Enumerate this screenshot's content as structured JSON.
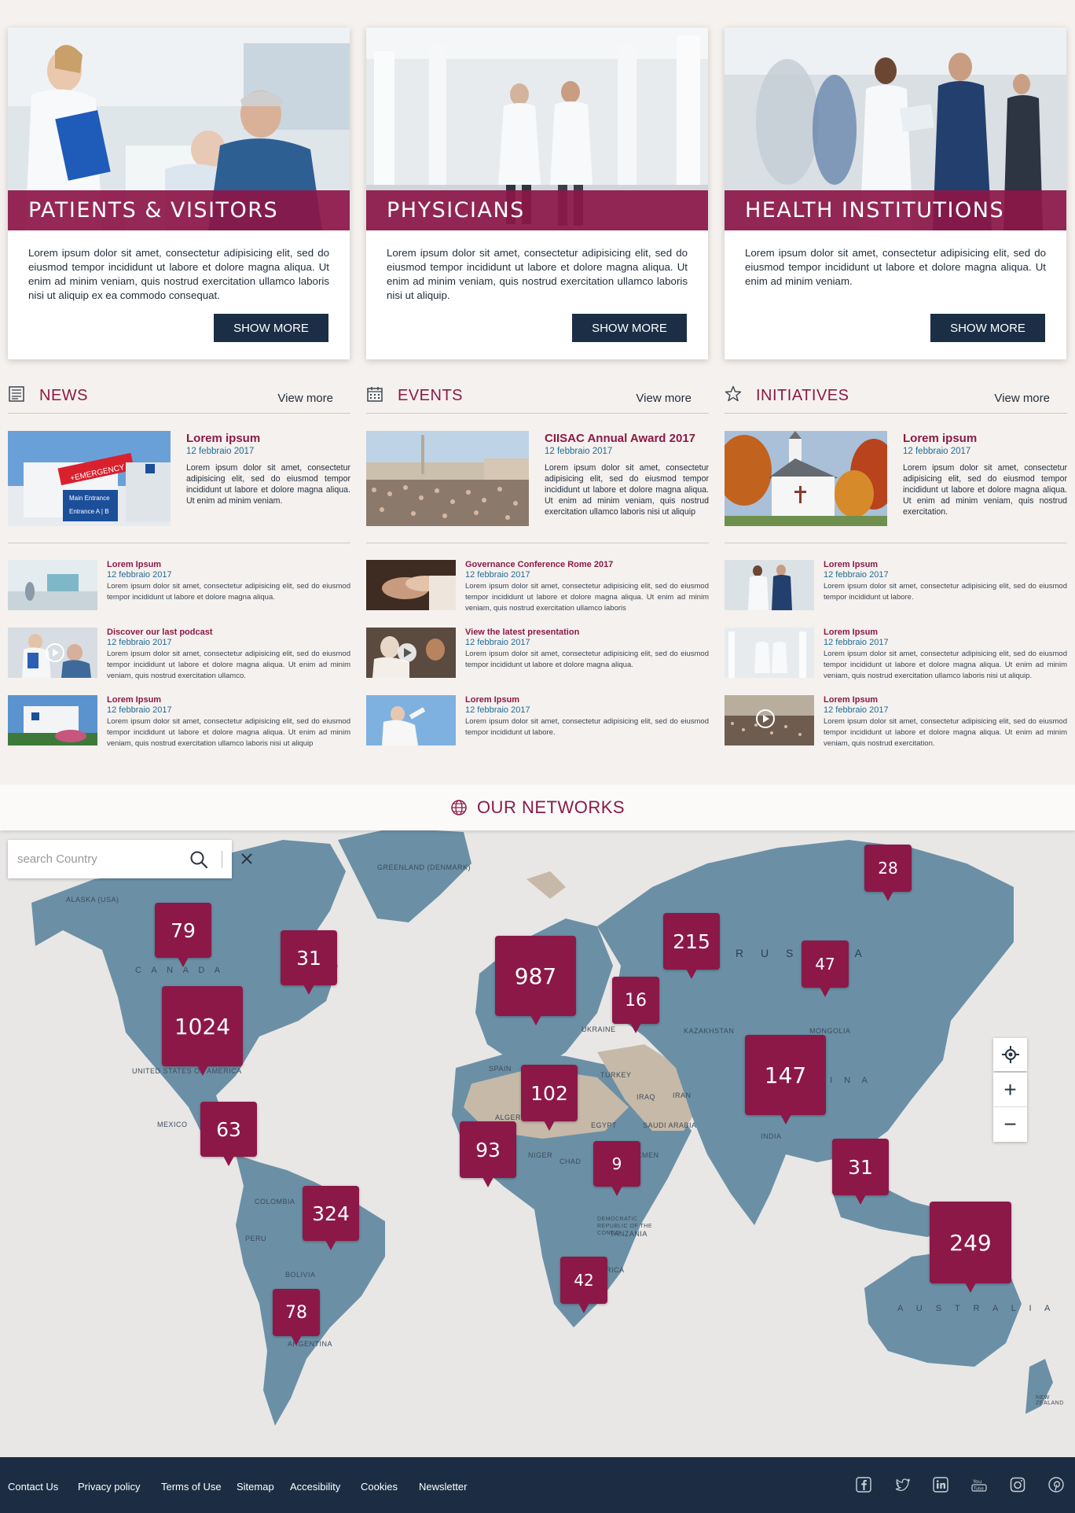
{
  "cards": [
    {
      "title": "PATIENTS & VISITORS",
      "text": "Lorem ipsum dolor sit amet, consectetur adipisicing elit, sed do eiusmod tempor incididunt ut labore et dolore magna aliqua. Ut enim ad minim veniam, quis nostrud exercitation ullamco laboris nisi ut aliquip ex ea commodo consequat.",
      "button": "SHOW MORE"
    },
    {
      "title": "PHYSICIANS",
      "text": "Lorem ipsum dolor sit amet, consectetur adipisicing elit, sed do eiusmod tempor incididunt ut labore et dolore magna aliqua. Ut enim ad minim veniam, quis nostrud exercitation ullamco laboris nisi ut aliquip.",
      "button": "SHOW MORE"
    },
    {
      "title": "HEALTH INSTITUTIONS",
      "text": "Lorem ipsum dolor sit amet, consectetur adipisicing elit, sed do eiusmod tempor incididunt ut labore et dolore magna aliqua. Ut enim ad minim veniam.",
      "button": "SHOW MORE"
    }
  ],
  "columns": [
    {
      "title": "NEWS",
      "icon": "newspaper-icon",
      "view_more": "View more",
      "featured": {
        "title": "Lorem ipsum",
        "date": "12 febbraio 2017",
        "text": "Lorem ipsum dolor sit amet, consectetur adipisicing elit, sed do eiusmod tempor incididunt ut labore et dolore magna aliqua. Ut enim ad minim veniam."
      },
      "items": [
        {
          "title": "Lorem Ipsum",
          "date": "12 febbraio 2017",
          "text": "Lorem ipsum dolor sit amet, consectetur adipisicing elit, sed do eiusmod tempor incididunt ut labore et dolore magna aliqua."
        },
        {
          "title": "Discover our last podcast",
          "date": "12 febbraio 2017",
          "text": "Lorem ipsum dolor sit amet, consectetur adipisicing elit, sed do eiusmod tempor incididunt ut labore et dolore magna aliqua. Ut enim ad minim veniam, quis nostrud exercitation ullamco."
        },
        {
          "title": "Lorem Ipsum",
          "date": "12 febbraio 2017",
          "text": "Lorem ipsum dolor sit amet, consectetur adipisicing elit, sed do eiusmod tempor incididunt ut labore et dolore magna aliqua. Ut enim ad minim veniam, quis nostrud exercitation ullamco laboris nisi ut aliquip"
        }
      ]
    },
    {
      "title": "EVENTS",
      "icon": "calendar-icon",
      "view_more": "View more",
      "featured": {
        "title": "CIISAC Annual Award 2017",
        "date": "12 febbraio 2017",
        "text": "Lorem ipsum dolor sit amet, consectetur adipisicing elit, sed do eiusmod tempor incididunt ut labore et dolore magna aliqua. Ut enim ad minim veniam, quis nostrud exercitation ullamco laboris nisi ut aliquip"
      },
      "items": [
        {
          "title": "Governance Conference Rome 2017",
          "date": "12 febbraio 2017",
          "text": "Lorem ipsum dolor sit amet, consectetur adipisicing elit, sed do eiusmod tempor incididunt ut labore et dolore magna aliqua. Ut enim ad minim veniam, quis nostrud exercitation ullamco laboris"
        },
        {
          "title": "View the latest presentation",
          "date": "12 febbraio 2017",
          "text": "Lorem ipsum dolor sit amet, consectetur adipisicing elit, sed do eiusmod tempor incididunt ut labore et dolore magna aliqua."
        },
        {
          "title": "Lorem Ipsum",
          "date": "12 febbraio 2017",
          "text": "Lorem ipsum dolor sit amet, consectetur adipisicing elit, sed do eiusmod tempor incididunt ut labore."
        }
      ]
    },
    {
      "title": "INITIATIVES",
      "icon": "star-icon",
      "view_more": "View more",
      "featured": {
        "title": "Lorem ipsum",
        "date": "12 febbraio 2017",
        "text": "Lorem ipsum dolor sit amet, consectetur adipisicing elit, sed do eiusmod tempor incididunt ut labore et dolore magna aliqua. Ut enim ad minim veniam, quis nostrud exercitation."
      },
      "items": [
        {
          "title": "Lorem Ipsum",
          "date": "12 febbraio 2017",
          "text": "Lorem ipsum dolor sit amet, consectetur adipisicing elit, sed do eiusmod tempor incididunt ut labore."
        },
        {
          "title": "Lorem Ipsum",
          "date": "12 febbraio 2017",
          "text": "Lorem ipsum dolor sit amet, consectetur adipisicing elit, sed do eiusmod tempor incididunt ut labore et dolore magna aliqua. Ut enim ad minim veniam, quis nostrud exercitation ullamco laboris nisi ut aliquip."
        },
        {
          "title": "Lorem Ipsum",
          "date": "12 febbraio 2017",
          "text": "Lorem ipsum dolor sit amet, consectetur adipisicing elit, sed do eiusmod tempor incididunt ut labore et dolore magna aliqua. Ut enim ad minim veniam, quis nostrud exercitation."
        }
      ]
    }
  ],
  "map": {
    "title": "OUR NETWORKS",
    "search_placeholder": "search Country",
    "labels": {
      "greenland": "GREENLAND (DENMARK)",
      "alaska": "ALASKA (USA)",
      "canada": "C A N A D A",
      "usa": "UNITED STATES OF AMERICA",
      "mexico": "MEXICO",
      "colombia": "COLOMBIA",
      "peru": "PERU",
      "bolivia": "BOLIVIA",
      "argentina": "ARGENTINA",
      "russia": "R U S S I A",
      "kazakhstan": "KAZAKHSTAN",
      "mongolia": "MONGOLIA",
      "china": "C H I N A",
      "india": "INDIA",
      "iran": "IRAN",
      "iraq": "IRAQ",
      "turkey": "TURKEY",
      "egypt": "EGYPT",
      "saudi": "SAUDI ARABIA",
      "algeria": "ALGERIA",
      "niger": "NIGER",
      "chad": "CHAD",
      "ukraine": "UKRAINE",
      "spain": "SPAIN",
      "australia": "A U S T R A L I A",
      "south_africa": "SOUTH AFRICA",
      "tanzania": "TANZANIA",
      "yemen": "YEMEN",
      "drc": "DEMOCRATIC REPUBLIC OF THE CONGO",
      "new_zealand": "NEW ZEALAND"
    },
    "pins": [
      {
        "id": "alaska-canada",
        "count": "79"
      },
      {
        "id": "east-canada",
        "count": "31"
      },
      {
        "id": "usa",
        "count": "1024"
      },
      {
        "id": "mexico",
        "count": "63"
      },
      {
        "id": "brazil",
        "count": "324"
      },
      {
        "id": "argentina",
        "count": "78"
      },
      {
        "id": "europe",
        "count": "987"
      },
      {
        "id": "ukraine",
        "count": "16"
      },
      {
        "id": "russia-west",
        "count": "215"
      },
      {
        "id": "russia-north",
        "count": "28"
      },
      {
        "id": "russia-east",
        "count": "47"
      },
      {
        "id": "mediterranean",
        "count": "102"
      },
      {
        "id": "west-africa",
        "count": "93"
      },
      {
        "id": "central-africa",
        "count": "9"
      },
      {
        "id": "southern-africa",
        "count": "42"
      },
      {
        "id": "india-china",
        "count": "147"
      },
      {
        "id": "southeast-asia",
        "count": "31"
      },
      {
        "id": "australia",
        "count": "249"
      }
    ],
    "controls": {
      "locate": "crosshair-icon",
      "zoom_in": "+",
      "zoom_out": "−"
    },
    "colors": {
      "land": "#6b90a6",
      "sea": "#e8e7e6",
      "desert": "#c7b9a8",
      "pin": "#8c1848"
    }
  },
  "footer": {
    "links": [
      "Contact Us",
      "Privacy policy",
      "Terms of Use",
      "Sitemap",
      "Accesibility",
      "Cookies",
      "Newsletter"
    ],
    "social": [
      "facebook-icon",
      "twitter-icon",
      "linkedin-icon",
      "youtube-icon",
      "instagram-icon",
      "pinterest-icon"
    ]
  }
}
